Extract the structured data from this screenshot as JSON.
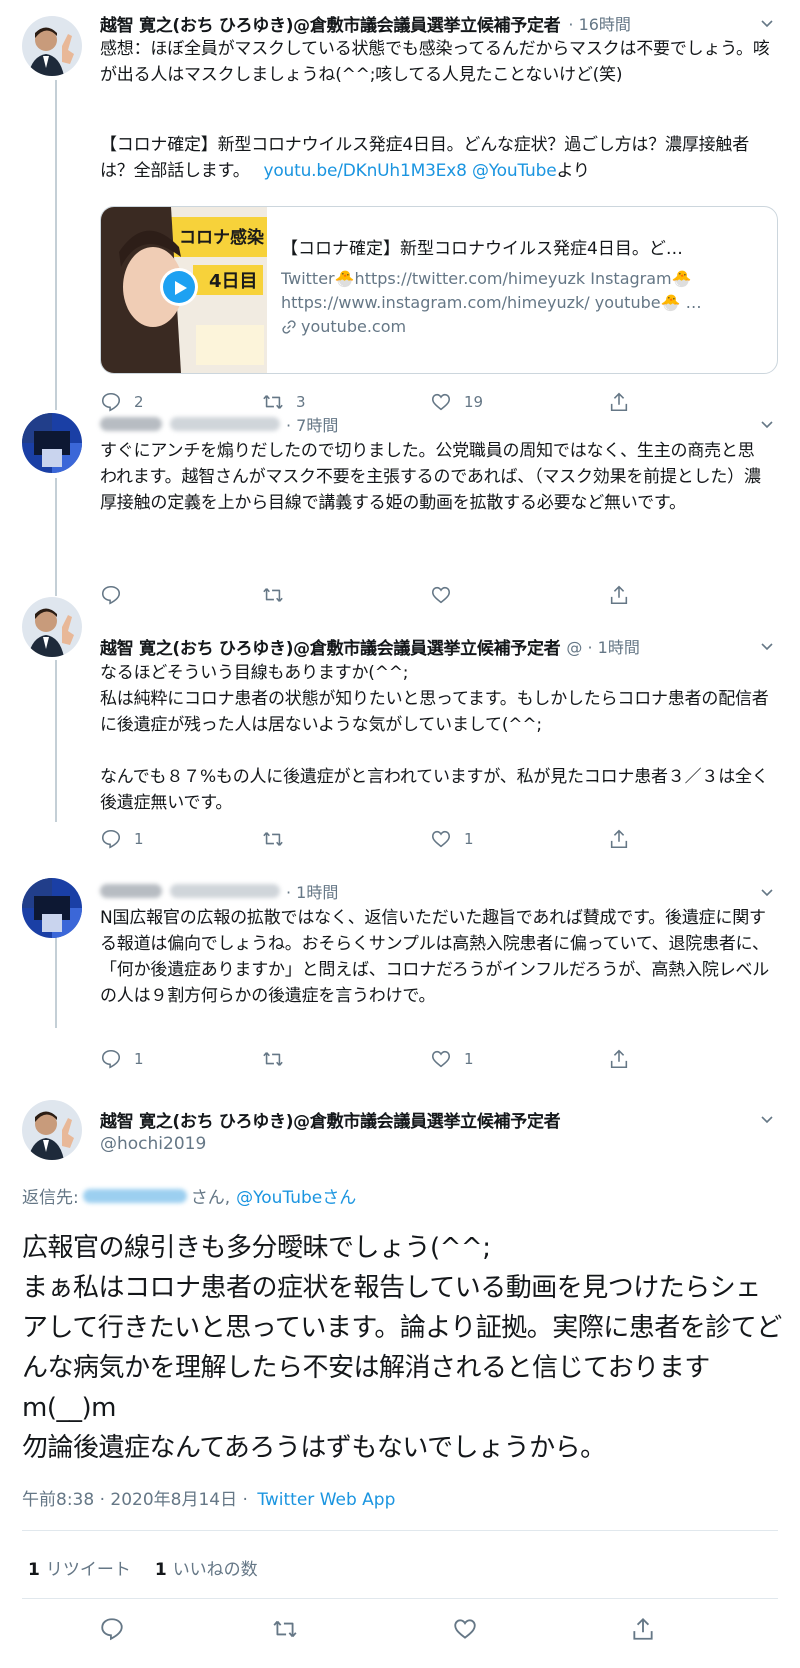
{
  "tweets": [
    {
      "author": "越智 寛之(おち ひろゆき)@倉敷市議会議員選挙立候補予定者",
      "time": "· 16時間",
      "text": "感想：ほぼ全員がマスクしている状態でも感染ってるんだからマスクは不要でしょう。咳が出る人はマスクしましょうね(^^;咳してる人見たことないけど(笑)",
      "text2": "【コロナ確定】新型コロナウイルス発症4日目。どんな症状？過ごし方は？濃厚接触者は？全部話します。",
      "link": "youtu.be/DKnUh1M3Ex8",
      "mention": "@YouTube",
      "after": "より",
      "card": {
        "title": "【コロナ確定】新型コロナウイルス発症4日目。ど…",
        "desc1": "Twitter🐣https://twitter.com/himeyuzk Instagram🐣",
        "desc2": "https://www.instagram.com/himeyuzk/ youtube🐣 …",
        "domain": "youtube.com",
        "thumb_text1": "コロナ感染",
        "thumb_text2": "4日目"
      },
      "replies": "2",
      "retweets": "3",
      "likes": "19"
    },
    {
      "time": "· 7時間",
      "text": "すぐにアンチを煽りだしたので切りました。公党職員の周知ではなく、生主の商売と思われます。越智さんがマスク不要を主張するのであれば、（マスク効果を前提とした）濃厚接触の定義を上から目線で講義する姫の動画を拡散する必要など無いです。",
      "replies": "",
      "retweets": "",
      "likes": ""
    },
    {
      "author": "越智 寛之(おち ひろゆき)@倉敷市議会議員選挙立候補予定者",
      "time": "@ · 1時間",
      "text": "なるほどそういう目線もありますか(^^;\n私は純粋にコロナ患者の状態が知りたいと思ってます。もしかしたらコロナ患者の配信者に後遺症が残った人は居ないような気がしていまして(^^;\n\nなんでも８７%もの人に後遺症がと言われていますが、私が見たコロナ患者３／３は全く後遺症無いです。",
      "replies": "1",
      "retweets": "",
      "likes": "1"
    },
    {
      "time": "· 1時間",
      "text": "N国広報官の広報の拡散ではなく、返信いただいた趣旨であれば賛成です。後遺症に関する報道は偏向でしょうね。おそらくサンプルは高熱入院患者に偏っていて、退院患者に、「何か後遺症ありますか」と問えば、コロナだろうがインフルだろうが、高熱入院レベルの人は９割方何らかの後遺症を言うわけで。",
      "replies": "1",
      "retweets": "",
      "likes": "1"
    }
  ],
  "main": {
    "author": "越智 寛之(おち ひろゆき)@倉敷市議会議員選挙立候補予定者",
    "handle": "@hochi2019",
    "reply_prefix": "返信先:",
    "reply_san1": "さん,",
    "reply_mention": "@YouTubeさん",
    "text": "広報官の線引きも多分曖昧でしょう(^^;\nまぁ私はコロナ患者の症状を報告している動画を見つけたらシェアして行きたいと思っています。論より証拠。実際に患者を診てどんな病気かを理解したら不安は解消されると信じておりますm(__)m\n勿論後遺症なんてあろうはずもないでしょうから。",
    "timestamp": "午前8:38 · 2020年8月14日 ·",
    "app": "Twitter Web App",
    "retweet_count": "1",
    "retweet_label": "リツイート",
    "like_count": "1",
    "like_label": "いいねの数"
  },
  "colors": {
    "link": "#1b95e0",
    "muted": "#657786",
    "text": "#14171a",
    "border": "#e1e8ed"
  },
  "icons": [
    "reply-icon",
    "retweet-icon",
    "like-icon",
    "share-icon",
    "chevron-down-icon",
    "link-icon",
    "play-icon"
  ]
}
